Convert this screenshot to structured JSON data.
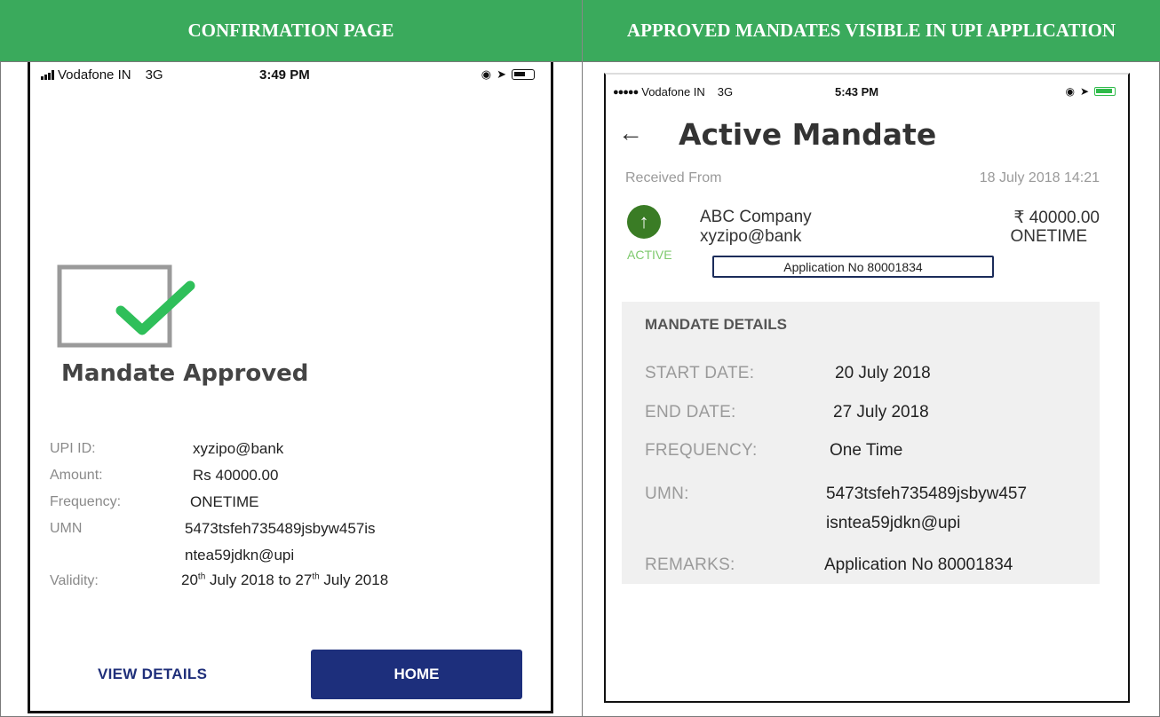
{
  "headers": {
    "left": "CONFIRMATION PAGE",
    "right": "APPROVED MANDATES VISIBLE IN UPI APPLICATION"
  },
  "left_phone": {
    "status_bar": {
      "carrier": "Vodafone IN",
      "network": "3G",
      "time": "3:49 PM"
    },
    "title": "Mandate Approved",
    "details": {
      "upi_label": "UPI ID:",
      "upi_value": "xyzipo@bank",
      "amount_label": "Amount:",
      "amount_value": "Rs 40000.00",
      "frequency_label": "Frequency:",
      "frequency_value": "ONETIME",
      "umn_label": "UMN",
      "umn_line1": "5473tsfeh735489jsbyw457is",
      "umn_line2": "ntea59jdkn@upi",
      "validity_label": "Validity:",
      "validity_day1": "20",
      "validity_sup1": "th",
      "validity_mid": " July 2018 to ",
      "validity_day2": "27",
      "validity_sup2": "th",
      "validity_end": " July 2018"
    },
    "buttons": {
      "view_details": "VIEW DETAILS",
      "home": "HOME"
    }
  },
  "right_phone": {
    "status_bar": {
      "carrier": "Vodafone IN",
      "network": "3G",
      "time": "5:43 PM"
    },
    "back_icon": "arrow-left-icon",
    "title": "Active Mandate",
    "received_from": "Received From",
    "received_date": "18 July 2018 14:21",
    "payee": {
      "name": "ABC Company",
      "upi": "xyzipo@bank",
      "amount": "₹ 40000.00",
      "type": "ONETIME",
      "status": "ACTIVE"
    },
    "application_no": "Application No 80001834",
    "details": {
      "heading": "MANDATE DETAILS",
      "start_label": "START DATE:",
      "start_value": "20 July 2018",
      "end_label": "END DATE:",
      "end_value": "27 July 2018",
      "frequency_label": "FREQUENCY:",
      "frequency_value": "One Time",
      "umn_label": "UMN:",
      "umn_line1": "5473tsfeh735489jsbyw457",
      "umn_line2": "isntea59jdkn@upi",
      "remarks_label": "REMARKS:",
      "remarks_value": "Application No 80001834"
    }
  },
  "colors": {
    "header_green": "#3aaa5c",
    "navy": "#1d2f7c",
    "active_green": "#3a7c25"
  }
}
